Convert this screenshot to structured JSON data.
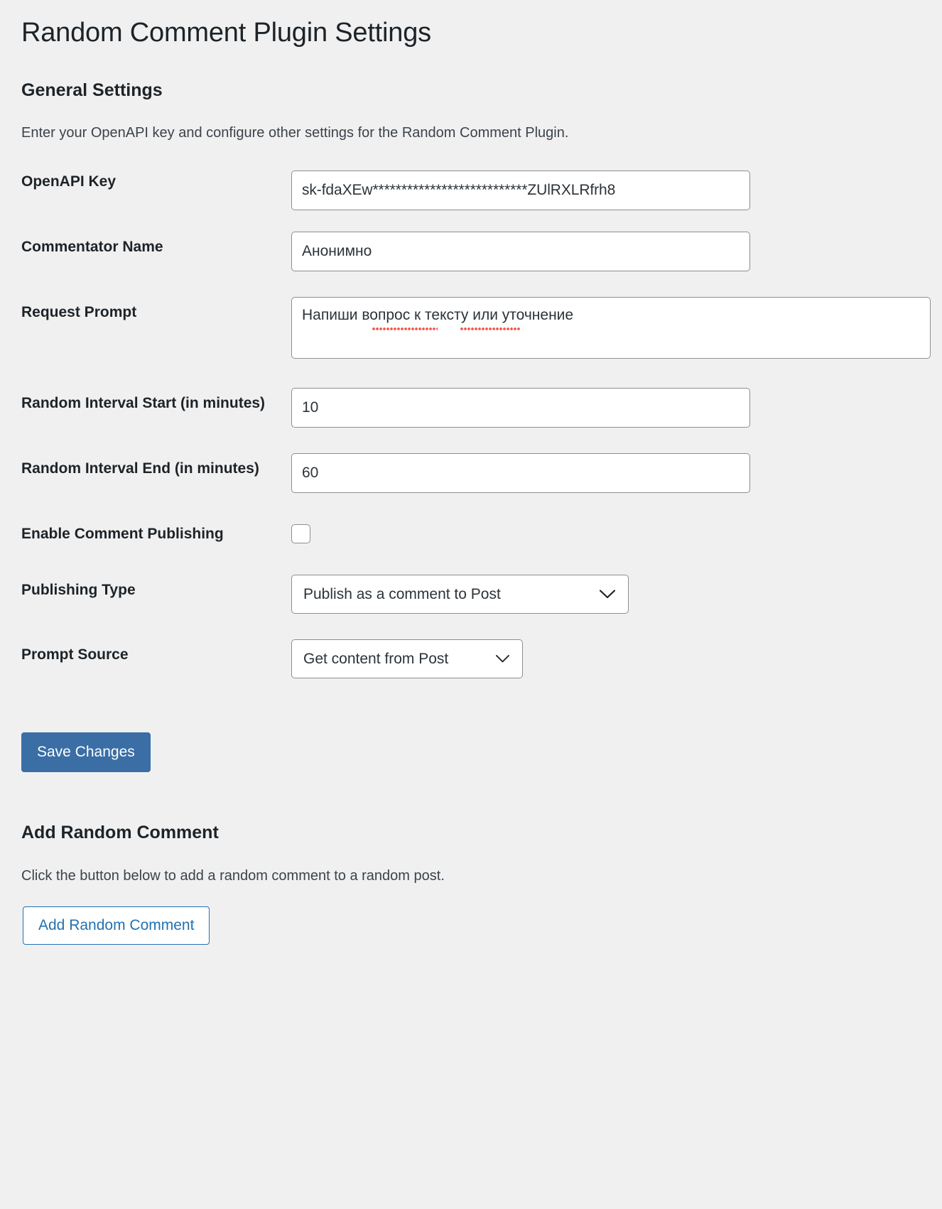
{
  "page": {
    "title": "Random Comment Plugin Settings"
  },
  "general": {
    "heading": "General Settings",
    "description": "Enter your OpenAPI key and configure other settings for the Random Comment Plugin.",
    "fields": {
      "openapi_key": {
        "label": "OpenAPI Key",
        "value": "sk-fdaXEw***************************ZUlRXLRfrh8",
        "placeholder": ""
      },
      "commentator_name": {
        "label": "Commentator Name",
        "value": "Анонимно",
        "placeholder": ""
      },
      "request_prompt": {
        "label": "Request Prompt",
        "value": "Напиши вопрос к тексту или уточнение",
        "placeholder": "",
        "misspelled_words": [
          "вопрос",
          "тексту"
        ]
      },
      "interval_start": {
        "label": "Random Interval Start (in minutes)",
        "value": "10",
        "placeholder": ""
      },
      "interval_end": {
        "label": "Random Interval End (in minutes)",
        "value": "60",
        "placeholder": ""
      },
      "enable_publishing": {
        "label": "Enable Comment Publishing",
        "checked": false
      },
      "publishing_type": {
        "label": "Publishing Type",
        "selected": "Publish as a comment to Post"
      },
      "prompt_source": {
        "label": "Prompt Source",
        "selected": "Get content from Post"
      }
    },
    "save_button": "Save Changes"
  },
  "add_comment": {
    "heading": "Add Random Comment",
    "description": "Click the button below to add a random comment to a random post.",
    "button": "Add Random Comment"
  },
  "colors": {
    "background": "#f0f0f1",
    "text": "#1d2327",
    "primary_button": "#3a6ea5",
    "link": "#2271b1",
    "field_border": "#8c8f94",
    "spellcheck": "#f2564a"
  }
}
